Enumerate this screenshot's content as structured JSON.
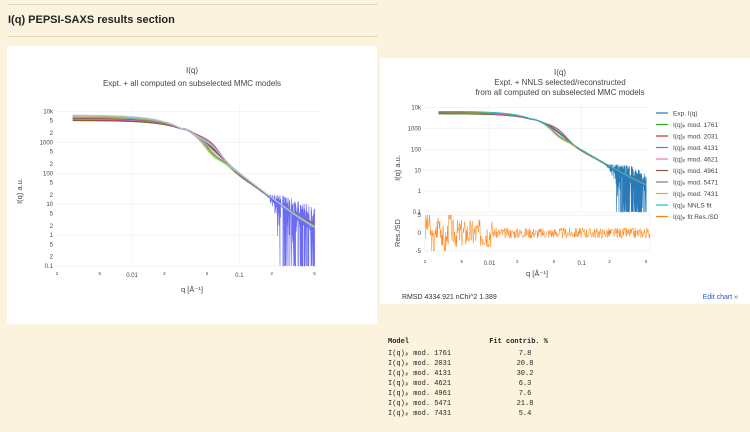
{
  "page": {
    "section_title": "I(q) PEPSI-SAXS results section"
  },
  "left_chart": {
    "title": "I(q)",
    "subtitle": "Expt. + all computed on subselected MMC models",
    "xlabel": "q [Å⁻¹]",
    "ylabel": "I(q) a.u.",
    "x_ticks_major": [
      "0.01",
      "0.1"
    ],
    "x_ticks_minor": [
      "2",
      "5",
      "2",
      "5",
      "2",
      "5"
    ],
    "y_ticks_major": [
      "10k",
      "1000",
      "100",
      "10",
      "1",
      "0.1"
    ],
    "y_ticks_minor": [
      "2",
      "5",
      "2",
      "5",
      "2",
      "5",
      "2",
      "5",
      "2",
      "5"
    ]
  },
  "right_chart": {
    "title": "I(q)",
    "subtitle_1": "Expt. + NNLS selected/reconstructed",
    "subtitle_2": "from all computed on subselected MMC models",
    "xlabel": "q [Å⁻¹]",
    "ylabel_top": "I(q) a.u.",
    "ylabel_bottom": "Res./SD",
    "x_ticks_major": [
      "0.01",
      "0.1"
    ],
    "x_ticks_minor": [
      "2",
      "5",
      "2",
      "5",
      "2",
      "5"
    ],
    "y_ticks_top": [
      "10k",
      "1000",
      "100",
      "10",
      "1",
      "0.1"
    ],
    "y_ticks_bottom": [
      "5",
      "0",
      "-5"
    ],
    "legend": [
      {
        "label": "Exp. I(q)",
        "color": "#1f77b4"
      },
      {
        "label": "I(q)ₚ mod. 1761",
        "color": "#2ca02c"
      },
      {
        "label": "I(q)ₚ mod. 2031",
        "color": "#d62728"
      },
      {
        "label": "I(q)ₚ mod. 4131",
        "color": "#9467bd"
      },
      {
        "label": "I(q)ₚ mod. 4621",
        "color": "#e377c2"
      },
      {
        "label": "I(q)ₚ mod. 4961",
        "color": "#8c564b"
      },
      {
        "label": "I(q)ₚ mod. 5471",
        "color": "#7f7f7f"
      },
      {
        "label": "I(q)ₚ mod. 7431",
        "color": "#bcbd22"
      },
      {
        "label": "I(q)ₚ NNLS fit",
        "color": "#17becf"
      },
      {
        "label": "I(q)ₚ fit Res./SD",
        "color": "#ff7f0e"
      }
    ],
    "rmsd_text": "RMSD 4334.921  nChi^2 1.389",
    "edit_link": "Edit chart »"
  },
  "chart_data": [
    {
      "type": "line",
      "title": "I(q)",
      "subtitle": "Expt. + all computed on subselected MMC models",
      "xlabel": "q [Å⁻¹]",
      "ylabel": "I(q) a.u.",
      "x_scale": "log",
      "y_scale": "log",
      "xlim": [
        0.002,
        0.55
      ],
      "ylim": [
        0.1,
        15000
      ],
      "series": [
        {
          "name": "Exp. I(q)",
          "x": [
            0.003,
            0.01,
            0.03,
            0.06,
            0.1,
            0.2,
            0.3,
            0.4,
            0.5
          ],
          "y": [
            6500,
            6400,
            5500,
            2000,
            300,
            45,
            15,
            6,
            3
          ]
        }
      ]
    },
    {
      "type": "line",
      "title": "I(q)",
      "subtitle": "Expt. + NNLS selected/reconstructed from all computed on subselected MMC models",
      "xlabel": "q [Å⁻¹]",
      "ylabel": "I(q) a.u.",
      "x_scale": "log",
      "y_scale": "log",
      "xlim": [
        0.002,
        0.55
      ],
      "ylim": [
        0.1,
        15000
      ],
      "series": [
        {
          "name": "Exp. I(q)",
          "x": [
            0.003,
            0.01,
            0.03,
            0.06,
            0.1,
            0.2,
            0.3,
            0.4,
            0.5
          ],
          "y": [
            6500,
            6400,
            5500,
            2000,
            300,
            45,
            15,
            6,
            3
          ]
        },
        {
          "name": "I(q)ₚ NNLS fit",
          "x": [
            0.003,
            0.01,
            0.03,
            0.06,
            0.1,
            0.2,
            0.3,
            0.4,
            0.5
          ],
          "y": [
            6500,
            6400,
            5500,
            2000,
            310,
            50,
            20,
            12,
            9
          ]
        }
      ]
    },
    {
      "type": "table",
      "columns": [
        "Model",
        "Fit contrib. %"
      ],
      "rows": [
        [
          "I(q)ₚ mod. 1761",
          "7.8"
        ],
        [
          "I(q)ₚ mod. 2031",
          "20.8"
        ],
        [
          "I(q)ₚ mod. 4131",
          "30.2"
        ],
        [
          "I(q)ₚ mod. 4621",
          "6.3"
        ],
        [
          "I(q)ₚ mod. 4961",
          "7.6"
        ],
        [
          "I(q)ₚ mod. 5471",
          "21.8"
        ],
        [
          "I(q)ₚ mod. 7431",
          "5.4"
        ]
      ]
    }
  ]
}
